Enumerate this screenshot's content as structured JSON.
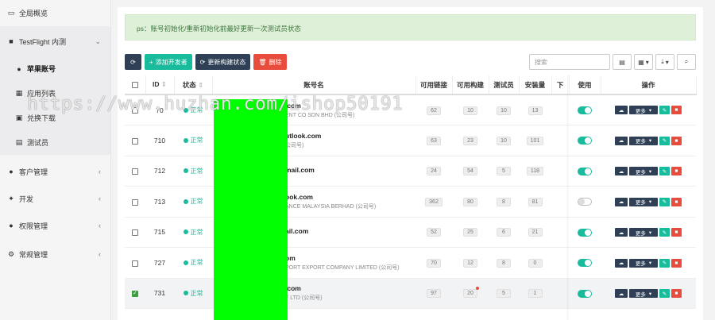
{
  "sidebar": {
    "items": [
      {
        "label": "全局概览",
        "icon": "monitor-icon"
      },
      {
        "label": "TestFlight 内测",
        "icon": "grid-icon",
        "chevron": "⌄"
      },
      {
        "label": "苹果账号",
        "icon": "apple-icon"
      },
      {
        "label": "应用列表",
        "icon": "apps-icon"
      },
      {
        "label": "兑换下载",
        "icon": "download-icon"
      },
      {
        "label": "测试员",
        "icon": "id-card-icon"
      },
      {
        "label": "客户管理",
        "icon": "user-icon",
        "chevron": "‹"
      },
      {
        "label": "开发",
        "icon": "magic-icon",
        "chevron": "‹"
      },
      {
        "label": "权限管理",
        "icon": "users-icon",
        "chevron": "‹"
      },
      {
        "label": "常规管理",
        "icon": "gears-icon",
        "chevron": "‹"
      }
    ]
  },
  "alert": {
    "text": "ps：账号初始化/重新初始化前最好更新一次测试员状态"
  },
  "toolbar": {
    "refresh": "⟳",
    "add": "添加开发者",
    "update": "更新构建状态",
    "delete": "删除"
  },
  "search": {
    "placeholder": "搜索"
  },
  "table": {
    "headers": [
      "ID",
      "状态",
      "账号名",
      "可用链接",
      "可用构建",
      "测试员",
      "安装量",
      "下",
      "使用",
      "操作"
    ],
    "rows": [
      {
        "id": "70",
        "status": "正常",
        "email": ".com",
        "company": "ENT CO SDN BHD (公司号)",
        "links": "62",
        "builds": "10",
        "testers": "10",
        "installs": "13",
        "enabled": true,
        "checked": false
      },
      {
        "id": "710",
        "status": "正常",
        "email": "utlook.com",
        "company": "公司号)",
        "links": "63",
        "builds": "23",
        "testers": "10",
        "installs": "101",
        "enabled": true,
        "checked": false
      },
      {
        "id": "712",
        "status": "正常",
        "email": "mail.com",
        "company": "",
        "links": "24",
        "builds": "54",
        "testers": "5",
        "installs": "118",
        "enabled": true,
        "checked": false
      },
      {
        "id": "713",
        "status": "正常",
        "email": "ook.com",
        "company": "ANCE MALAYSIA BERHAD (公司号)",
        "links": "362",
        "builds": "80",
        "testers": "8",
        "installs": "81",
        "enabled": false,
        "checked": false
      },
      {
        "id": "715",
        "status": "正常",
        "email": "ail.com",
        "company": "",
        "links": "52",
        "builds": "25",
        "testers": "6",
        "installs": "21",
        "enabled": true,
        "checked": false
      },
      {
        "id": "727",
        "status": "正常",
        "email": "om",
        "company": "PORT EXPORT COMPANY LIMITED (公司号)",
        "links": "70",
        "builds": "12",
        "testers": "8",
        "installs": "0",
        "enabled": true,
        "checked": false
      },
      {
        "id": "731",
        "status": "正常",
        "email": ".com",
        "company": "F LTD (公司号)",
        "links": "97",
        "builds": "20",
        "testers": "5",
        "installs": "1",
        "enabled": true,
        "checked": true
      }
    ],
    "ops": {
      "more": "更多"
    }
  },
  "watermark": "https://www.huzhan.com/ishop50191"
}
